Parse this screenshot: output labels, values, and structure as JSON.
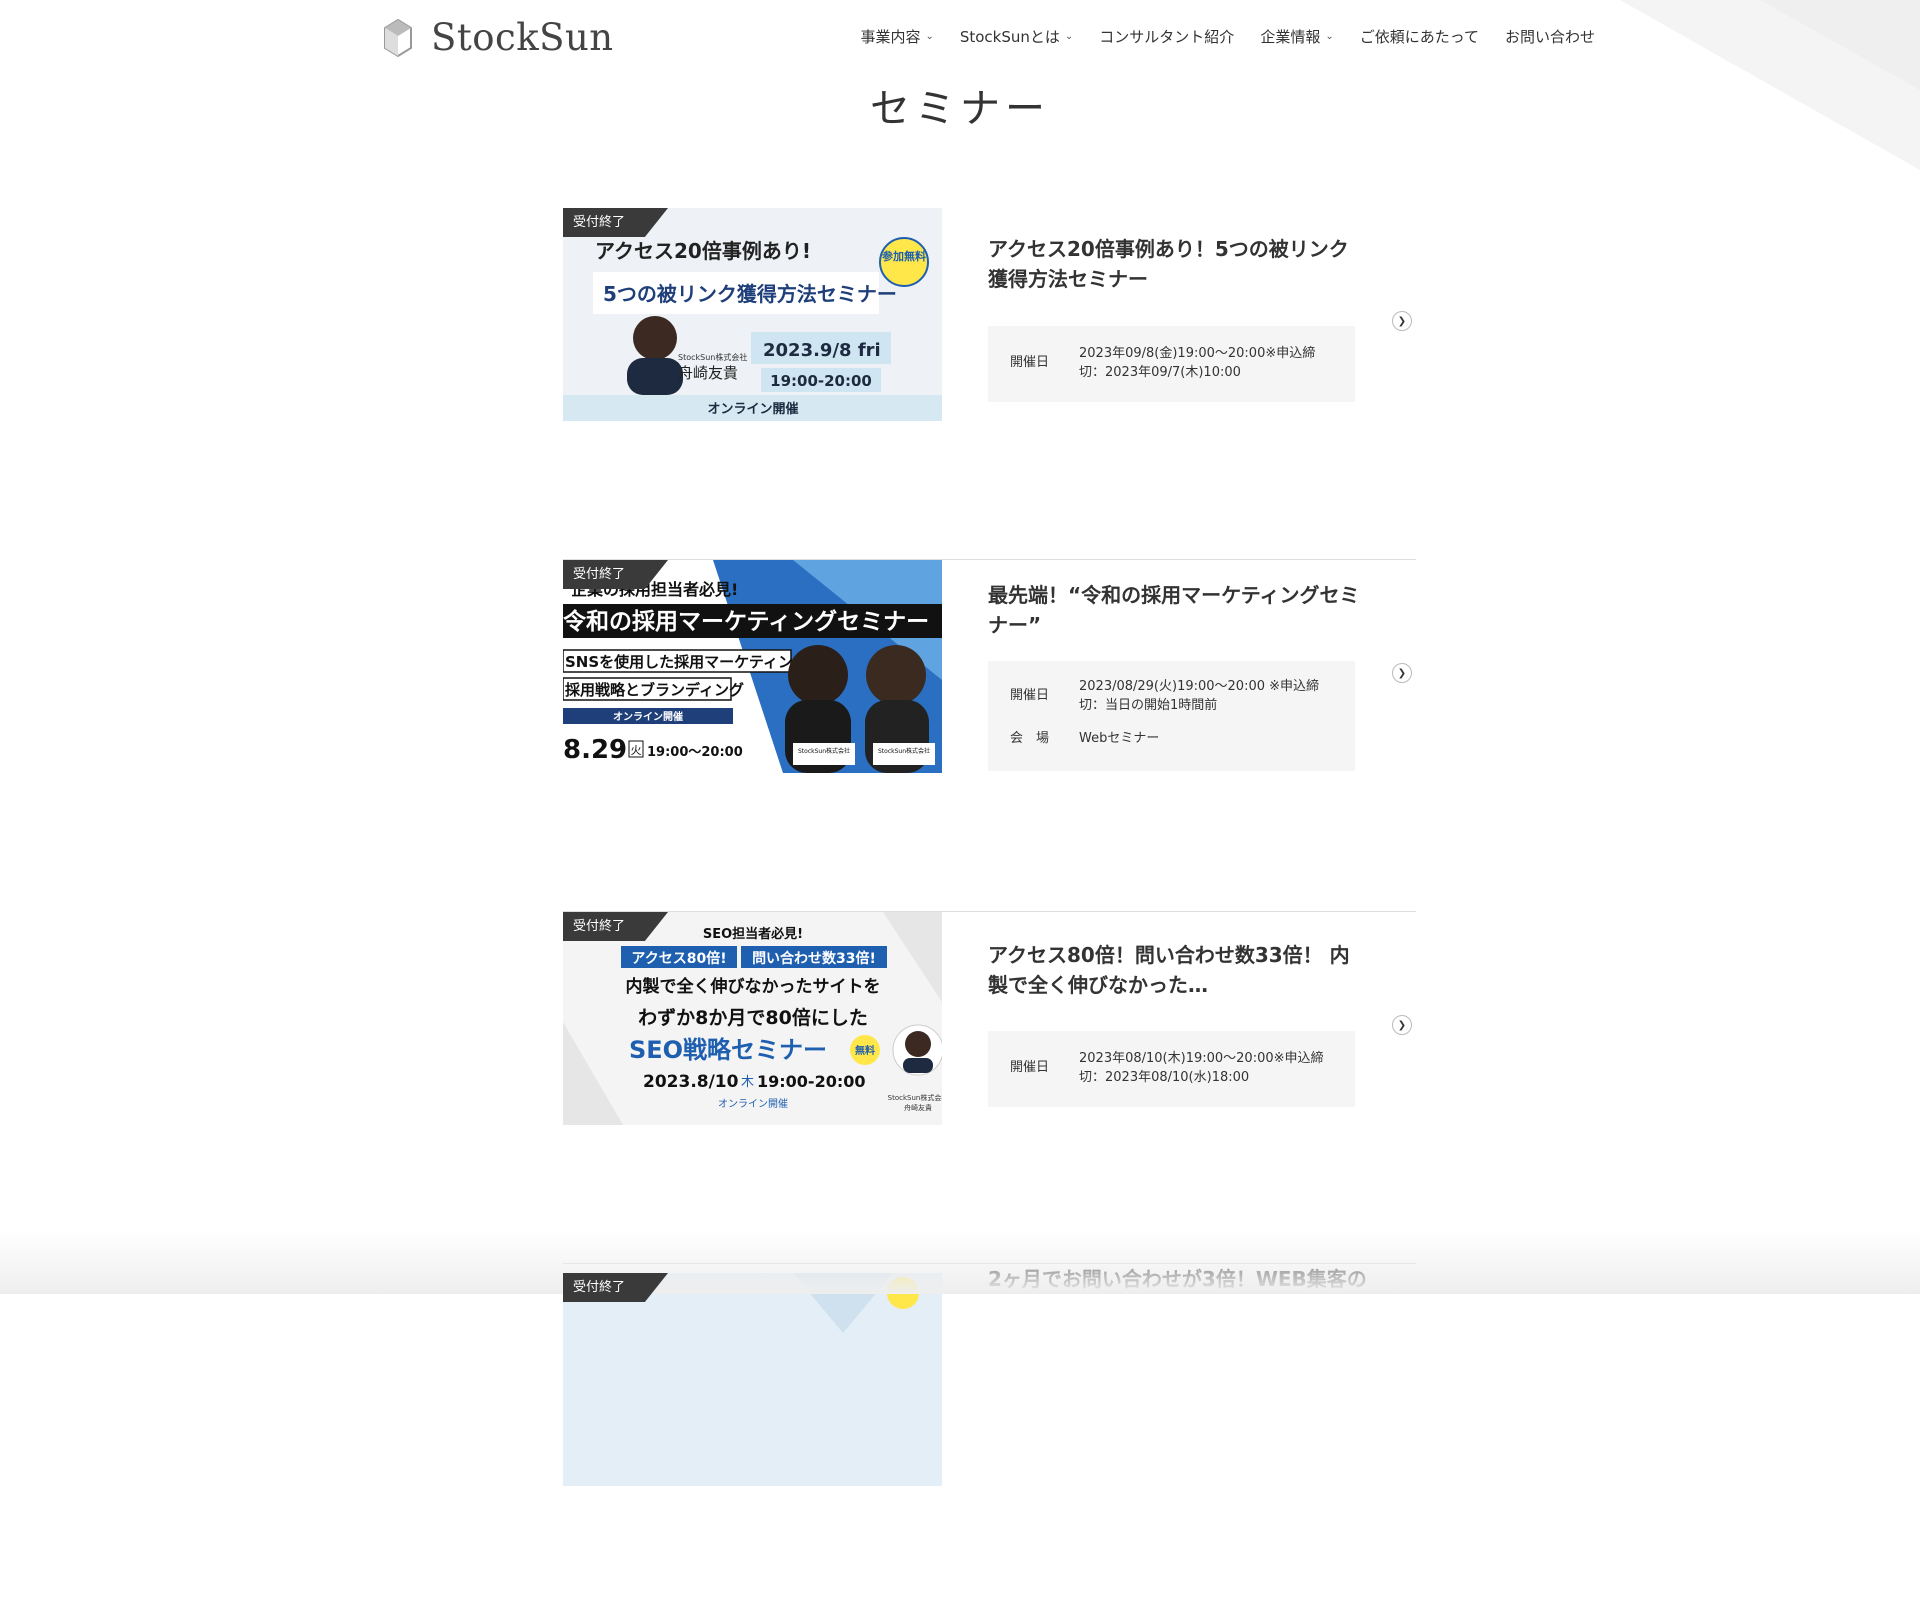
{
  "header": {
    "logo_text": "StockSun",
    "nav": [
      {
        "label": "事業内容",
        "has_caret": true
      },
      {
        "label": "StockSunとは",
        "has_caret": true
      },
      {
        "label": "コンサルタント紹介",
        "has_caret": false
      },
      {
        "label": "企業情報",
        "has_caret": true
      },
      {
        "label": "ご依頼にあたって",
        "has_caret": false
      },
      {
        "label": "お問い合わせ",
        "has_caret": false
      }
    ],
    "caret_glyph": "⌄"
  },
  "page_title": "セミナー",
  "seminars": [
    {
      "status": "受付終了",
      "title": "アクセス20倍事例あり！5つの被リンク獲得方法セミナー",
      "meta": [
        {
          "label": "開催日",
          "value": "2023年09/8(金)19:00〜20:00※申込締切：2023年09/7(木)10:00"
        }
      ],
      "banner": {
        "line1": "アクセス20倍事例あり!",
        "line2": "5つの被リンク獲得方法セミナー",
        "badge": "参加無料",
        "company": "StockSun株式会社",
        "speaker": "舟崎友貴",
        "date": "2023.9/8 fri",
        "time": "19:00-20:00",
        "footer": "オンライン開催"
      }
    },
    {
      "status": "受付終了",
      "title": "最先端！“令和の採用マーケティングセミナー”",
      "meta": [
        {
          "label": "開催日",
          "value": "2023/08/29(火)19:00〜20:00 ※申込締切：当日の開始1時間前"
        },
        {
          "label": "会　場",
          "value": "Webセミナー"
        }
      ],
      "banner": {
        "line0": "企業の採用担当者必見!",
        "line1": "令和の採用マーケティングセミナー",
        "line2": "SNSを使用した採用マーケティング",
        "line3": "採用戦略とブランディング",
        "online": "オンライン開催",
        "date": "8.29",
        "dow": "火",
        "time": "19:00〜20:00",
        "company1": "StockSun株式会社",
        "company2": "StockSun株式会社"
      }
    },
    {
      "status": "受付終了",
      "title": "アクセス80倍！問い合わせ数33倍！ 内製で全く伸びなかった…",
      "meta": [
        {
          "label": "開催日",
          "value": "2023年08/10(木)19:00〜20:00※申込締切：2023年08/10(水)18:00"
        }
      ],
      "banner": {
        "line0": "SEO担当者必見!",
        "tag1": "アクセス80倍!",
        "tag2": "問い合わせ数33倍!",
        "line1": "内製で全く伸びなかったサイトを",
        "line2": "わずか8か月で80倍にした",
        "line3": "SEO戦略セミナー",
        "badge": "無料",
        "date": "2023.8/10",
        "dow": "木",
        "time": "19:00-20:00",
        "online": "オンライン開催",
        "company": "StockSun株式会社",
        "speaker": "舟崎友貴"
      }
    },
    {
      "status": "受付終了",
      "title": "2ヶ月でお問い合わせが3倍！WEB集客の"
    }
  ],
  "colors": {
    "accent_blue": "#1f5fb0",
    "ribbon": "#3a3a3a",
    "meta_bg": "#f5f5f5"
  }
}
